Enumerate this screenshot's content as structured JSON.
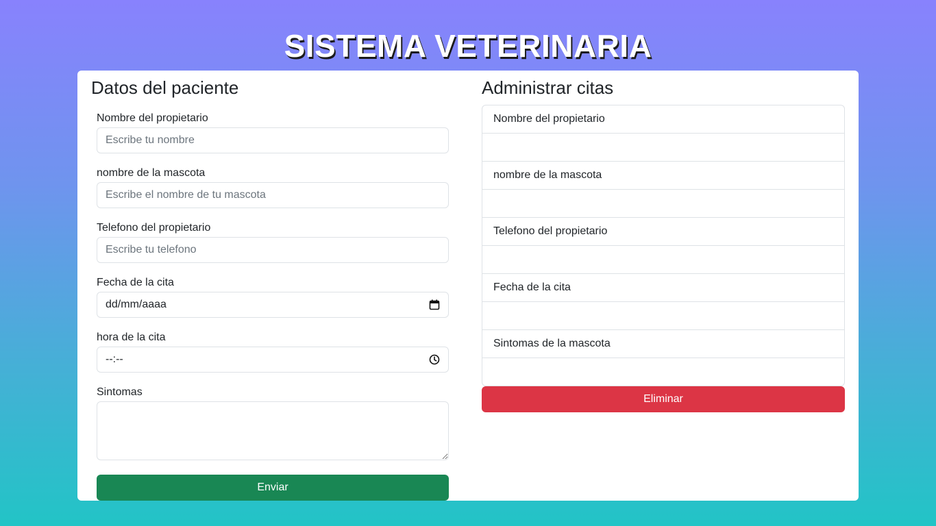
{
  "app": {
    "title": "SISTEMA VETERINARIA"
  },
  "form": {
    "heading": "Datos del paciente",
    "owner_name": {
      "label": "Nombre del propietario",
      "placeholder": "Escribe tu nombre",
      "value": ""
    },
    "pet_name": {
      "label": "nombre de la mascota",
      "placeholder": "Escribe el nombre de tu mascota",
      "value": ""
    },
    "phone": {
      "label": "Telefono del propietario",
      "placeholder": "Escribe tu telefono",
      "value": ""
    },
    "date": {
      "label": "Fecha de la cita",
      "display": "dd/mm/aaaa",
      "icon": "calendar-icon"
    },
    "time": {
      "label": "hora de la cita",
      "display": "--:--",
      "icon": "clock-icon"
    },
    "symptoms": {
      "label": "Sintomas",
      "value": ""
    },
    "submit_label": "Enviar"
  },
  "appointments": {
    "heading": "Administrar citas",
    "items": [
      "Nombre del propietario",
      "",
      "nombre de la mascota",
      "",
      "Telefono del propietario",
      "",
      "Fecha de la cita",
      "",
      "Sintomas de la mascota",
      ""
    ],
    "delete_label": "Eliminar"
  },
  "colors": {
    "success": "#198754",
    "danger": "#dc3545",
    "gradient_top": "#8882fd",
    "gradient_bottom": "#22c4c6"
  }
}
